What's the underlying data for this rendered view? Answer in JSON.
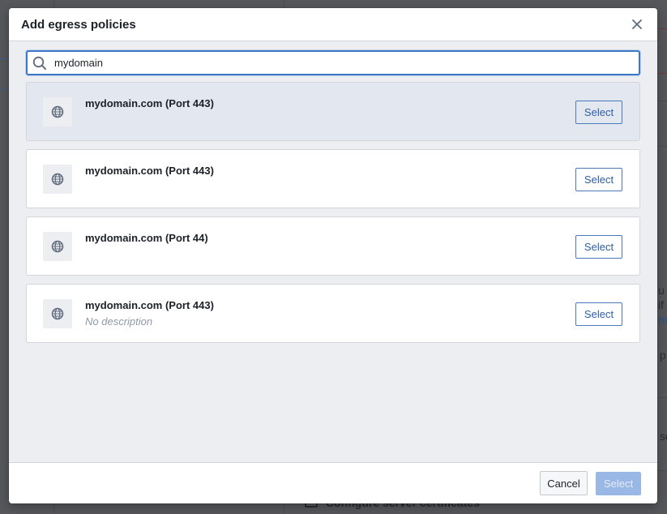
{
  "background": {
    "texts": [
      {
        "text": "u",
        "style": "normal"
      },
      {
        "text": "if",
        "style": "normal"
      },
      {
        "text": "m",
        "style": "link"
      },
      {
        "text": "p",
        "style": "normal"
      },
      {
        "text": "sc",
        "style": "normal"
      }
    ],
    "configure_label": "Configure server certificates"
  },
  "dialog": {
    "title": "Add egress policies",
    "close_icon": "close-icon",
    "search": {
      "value": "mydomain",
      "placeholder": "",
      "icon": "search-icon"
    },
    "items": [
      {
        "title": "mydomain.com (Port 443)",
        "description": "",
        "icon": "globe-icon",
        "button": "Select",
        "highlighted": true
      },
      {
        "title": "mydomain.com (Port 443)",
        "description": "",
        "icon": "globe-icon",
        "button": "Select",
        "highlighted": false
      },
      {
        "title": "mydomain.com (Port 44)",
        "description": "",
        "icon": "globe-icon",
        "button": "Select",
        "highlighted": false
      },
      {
        "title": "mydomain.com (Port 443)",
        "description": "No description",
        "icon": "globe-icon",
        "button": "Select",
        "highlighted": false
      }
    ],
    "footer": {
      "cancel_label": "Cancel",
      "select_label": "Select"
    }
  },
  "colors": {
    "accent": "#2d72d2",
    "select_disabled": "#99b8e6",
    "highlight_row": "#e2e7f0",
    "body_bg": "#edeef2"
  }
}
